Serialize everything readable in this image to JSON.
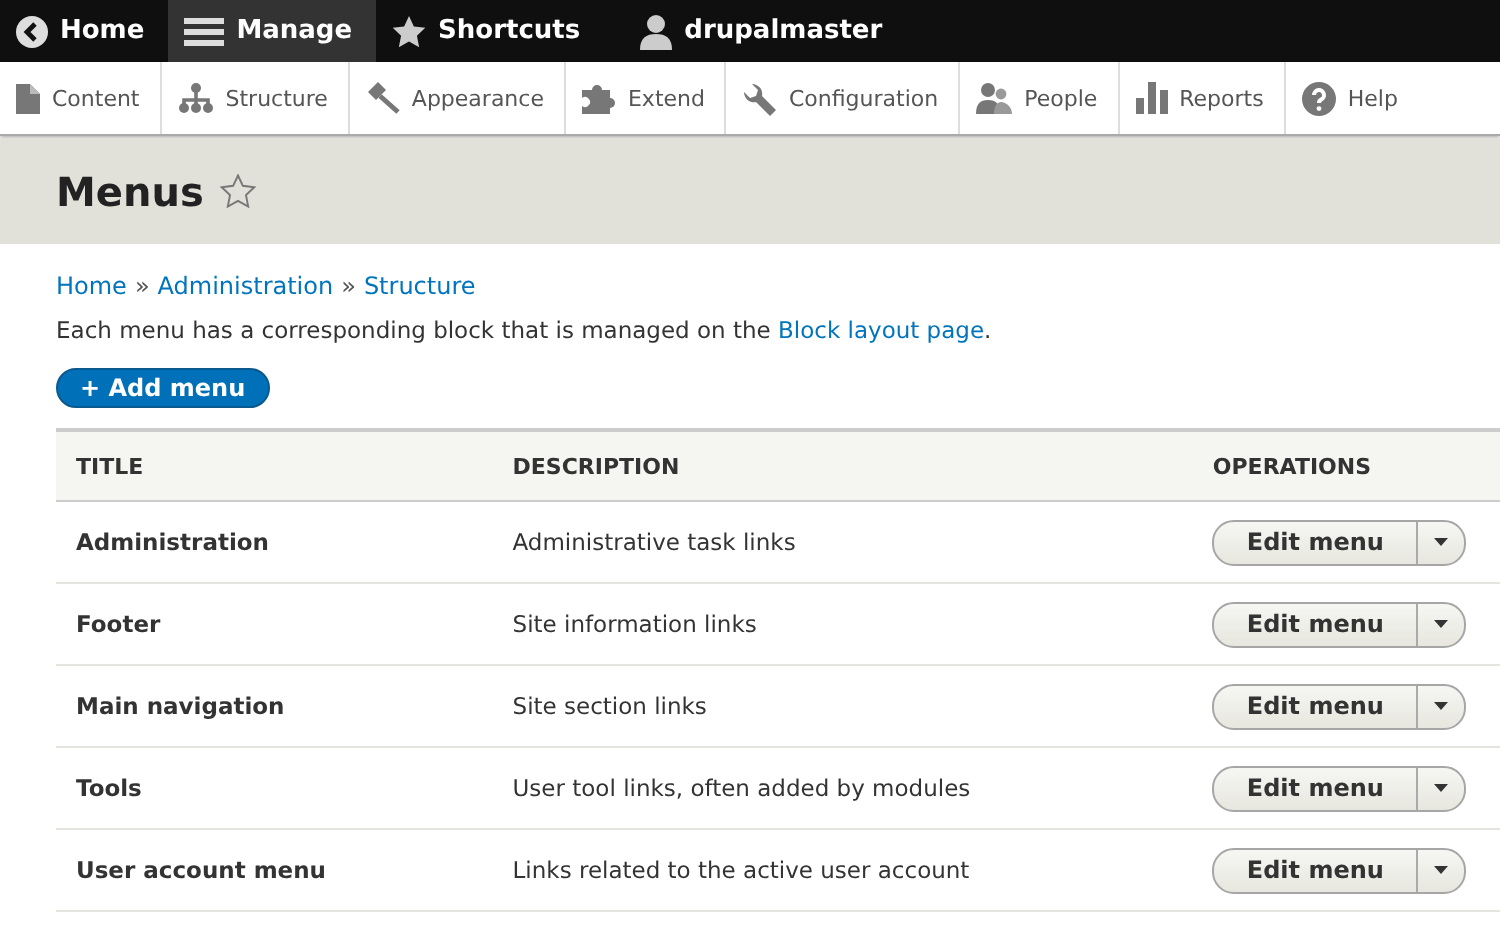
{
  "toolbar": {
    "items": [
      {
        "kind": "home",
        "label": "Home",
        "selected": false
      },
      {
        "kind": "manage",
        "label": "Manage",
        "selected": true
      },
      {
        "kind": "shortcuts",
        "label": "Shortcuts",
        "selected": false
      },
      {
        "kind": "user",
        "label": "drupalmaster",
        "selected": false
      }
    ]
  },
  "tray": {
    "items": [
      {
        "kind": "content",
        "label": "Content"
      },
      {
        "kind": "structure",
        "label": "Structure"
      },
      {
        "kind": "appearance",
        "label": "Appearance"
      },
      {
        "kind": "extend",
        "label": "Extend"
      },
      {
        "kind": "configuration",
        "label": "Configuration"
      },
      {
        "kind": "people",
        "label": "People"
      },
      {
        "kind": "reports",
        "label": "Reports"
      },
      {
        "kind": "help",
        "label": "Help"
      }
    ]
  },
  "page": {
    "title": "Menus",
    "starred": false
  },
  "breadcrumb": {
    "links": [
      "Home",
      "Administration",
      "Structure"
    ],
    "separator": "»"
  },
  "description": {
    "text": "Each menu has a corresponding block that is managed on the",
    "link": "Block layout page",
    "end": "."
  },
  "add_button": "+ Add menu",
  "table": {
    "columns": [
      "TITLE",
      "DESCRIPTION",
      "OPERATIONS"
    ],
    "rows": [
      {
        "title": "Administration",
        "description": "Administrative task links",
        "operation": "Edit menu"
      },
      {
        "title": "Footer",
        "description": "Site information links",
        "operation": "Edit menu"
      },
      {
        "title": "Main navigation",
        "description": "Site section links",
        "operation": "Edit menu"
      },
      {
        "title": "Tools",
        "description": "User tool links, often added by modules",
        "operation": "Edit menu"
      },
      {
        "title": "User account menu",
        "description": "Links related to the active user account",
        "operation": "Edit menu"
      }
    ]
  }
}
